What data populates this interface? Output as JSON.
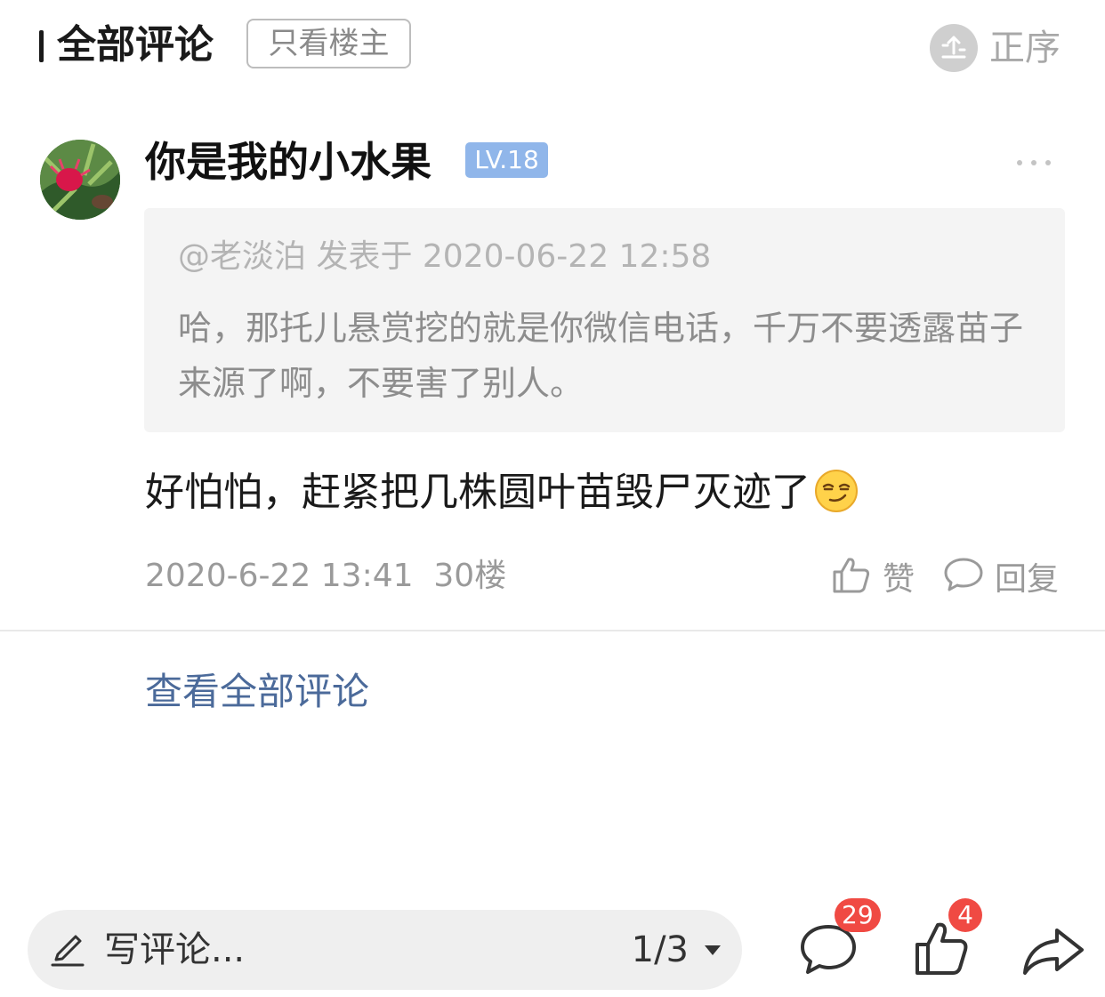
{
  "header": {
    "title": "全部评论",
    "filter_label": "只看楼主",
    "sort_label": "正序",
    "sort_icon": "sort-order-icon"
  },
  "comment": {
    "username": "你是我的小水果",
    "level": "LV.18",
    "quote": {
      "meta": "@老淡泊 发表于 2020-06-22 12:58",
      "text": "哈，那托儿悬赏挖的就是你微信电话，千万不要透露苗子来源了啊，不要害了别人。"
    },
    "text": "好怕怕，赶紧把几株圆叶苗毁尸灭迹了",
    "emoji": "smirk-emoji",
    "time": "2020-6-22 13:41",
    "floor": "30楼",
    "like_label": "赞",
    "reply_label": "回复"
  },
  "view_all": "查看全部评论",
  "bottom_bar": {
    "input_placeholder": "写评论...",
    "page_indicator": "1/3",
    "comment_count": "29",
    "like_count": "4",
    "icons": [
      "pencil-icon",
      "comment-icon",
      "thumbs-up-icon",
      "share-icon"
    ]
  },
  "colors": {
    "badge_red": "#f04a43",
    "level_blue": "#90b6ea",
    "link_blue": "#4b6a9a"
  }
}
